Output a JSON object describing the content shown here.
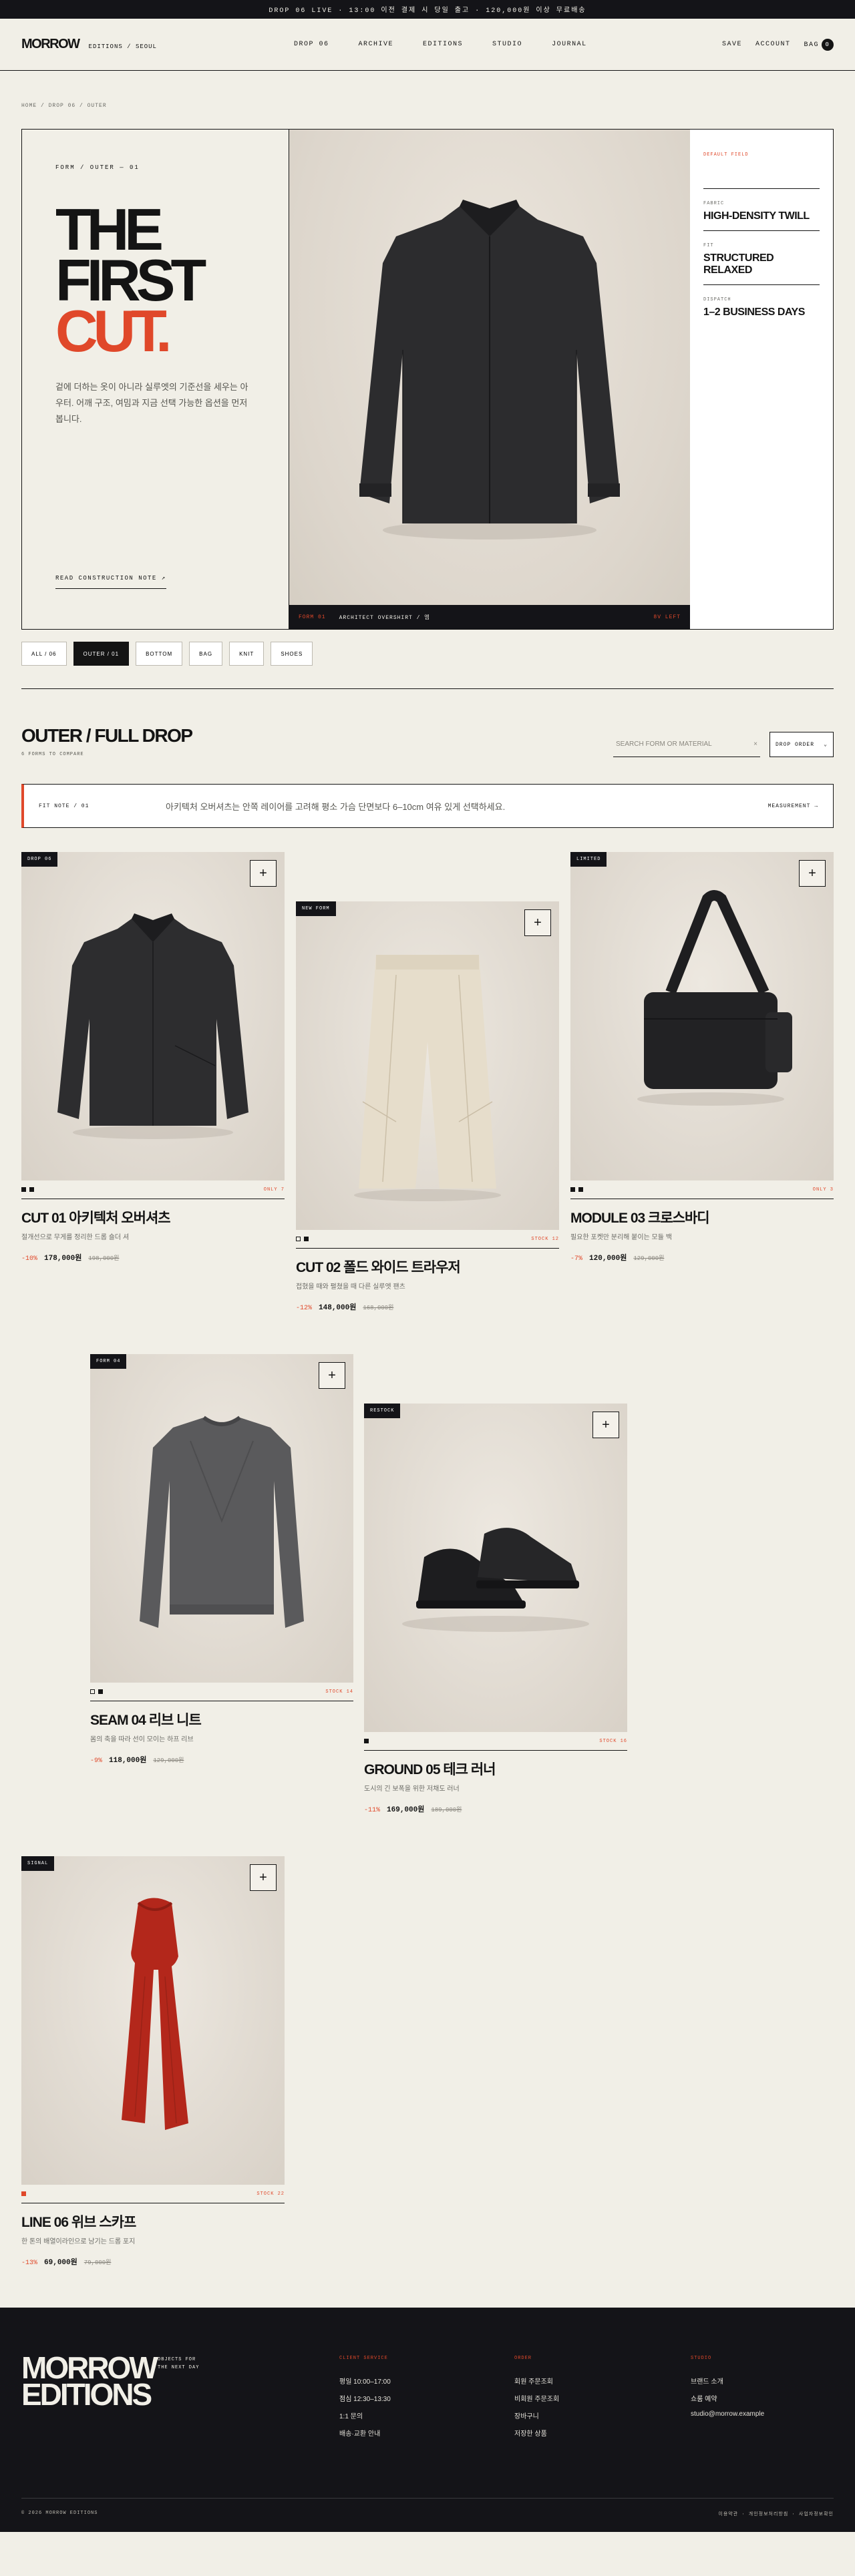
{
  "topbar": {
    "text": "DROP 06 LIVE  ·  13:00 이전 결제 시 당일 출고  ·  120,000원 이상 무료배송"
  },
  "header": {
    "brand": "MORROW",
    "brand_sub": "EDITIONS / SEOUL",
    "nav": [
      "DROP 06",
      "ARCHIVE",
      "EDITIONS",
      "STUDIO",
      "JOURNAL"
    ],
    "save": "SAVE",
    "account": "ACCOUNT",
    "bag": "BAG",
    "bag_count": "0"
  },
  "breadcrumb": "HOME  /  DROP 06  /  OUTER",
  "hero": {
    "label": "FORM / OUTER — 01",
    "title_1": "THE",
    "title_2": "FIRST",
    "title_3": "CUT.",
    "description": "겉에 더하는 옷이 아니라 실루엣의 기준선을 세우는 아우터. 어깨 구조, 여밈과 지금 선택 가능한 옵션을 먼저 봅니다.",
    "link": "READ CONSTRUCTION NOTE  ↗",
    "caption_code": "FORM 01",
    "caption_title": "ARCHITECT OVERSHIRT / 엠",
    "caption_stock": "8V LEFT",
    "spec_head": "DEFAULT FIELD",
    "specs": [
      {
        "label": "FABRIC",
        "value": "HIGH-DENSITY TWILL"
      },
      {
        "label": "FIT",
        "value": "STRUCTURED RELAXED"
      },
      {
        "label": "DISPATCH",
        "value": "1–2 BUSINESS DAYS"
      }
    ]
  },
  "filters": [
    "ALL / 06",
    "OUTER / 01",
    "BOTTOM",
    "BAG",
    "KNIT",
    "SHOES"
  ],
  "listing": {
    "title": "OUTER / FULL DROP",
    "subtitle": "6 FORMS TO COMPARE",
    "search_placeholder": "SEARCH FORM OR MATERIAL",
    "sort_label": "DROP ORDER"
  },
  "fit_note": {
    "label": "FIT NOTE / 01",
    "text": "아키텍처 오버셔츠는 안쪽 레이어를 고려해 평소 가슴 단면보다 6–10cm 여유 있게 선택하세요.",
    "link": "MEASUREMENT →"
  },
  "products": [
    {
      "badge": "DROP 06",
      "stock": "ONLY 7",
      "name": "CUT 01 아키텍처 오버셔츠",
      "desc": "절개선으로 무게를 정리한 드롭 숄더 셔",
      "discount": "-10%",
      "price": "178,000원",
      "original": "198,000원"
    },
    {
      "badge": "NEW FORM",
      "stock": "STOCK 12",
      "name": "CUT 02 폴드 와이드 트라우저",
      "desc": "접혔을 때와 펼쳤을 때 다른 실루엣 팬츠",
      "discount": "-12%",
      "price": "148,000원",
      "original": "168,000원"
    },
    {
      "badge": "LIMITED",
      "stock": "ONLY 3",
      "name": "MODULE 03 크로스바디",
      "desc": "필요한 포켓만 분리해 붙이는 모듈 백",
      "discount": "-7%",
      "price": "120,000원",
      "original": "129,000원"
    },
    {
      "badge": "FORM 04",
      "stock": "STOCK 14",
      "name": "SEAM 04 리브 니트",
      "desc": "몸의 축을 따라 선이 모이는 하프 리브",
      "discount": "-9%",
      "price": "118,000원",
      "original": "129,000원"
    },
    {
      "badge": "RESTOCK",
      "stock": "STOCK 16",
      "name": "GROUND 05 테크 러너",
      "desc": "도시의 긴 보폭을 위한 저채도 러너",
      "discount": "-11%",
      "price": "169,000원",
      "original": "189,000원"
    },
    {
      "badge": "SIGNAL",
      "stock": "STOCK 22",
      "name": "LINE 06 위브 스카프",
      "desc": "한 톤의 배열이라인으로 남기는 드롭 포지",
      "discount": "-13%",
      "price": "69,000원",
      "original": "79,000원"
    }
  ],
  "footer": {
    "brand_1": "MORROW",
    "brand_2": "EDITIONS",
    "tagline_1": "OBJECTS FOR",
    "tagline_2": "THE NEXT DAY",
    "columns": [
      {
        "title": "CLIENT SERVICE",
        "items": [
          "평일 10:00–17:00",
          "점심 12:30–13:30",
          "1:1 문의",
          "배송·교환 안내"
        ]
      },
      {
        "title": "ORDER",
        "items": [
          "회원 주문조회",
          "비회원 주문조회",
          "장바구니",
          "저장한 상품"
        ]
      },
      {
        "title": "STUDIO",
        "items": [
          "브랜드 소개",
          "쇼룸 예약",
          "studio@morrow.example"
        ]
      }
    ],
    "copyright": "© 2026 MORROW EDITIONS",
    "legal": "이용약관 · 개인정보처리방침 · 사업자정보확인"
  }
}
